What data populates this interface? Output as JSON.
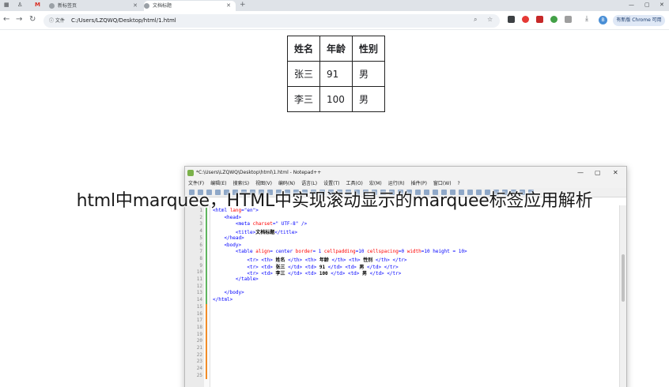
{
  "browser": {
    "tabs": [
      {
        "label": "新标签页"
      },
      {
        "label": "文档标题"
      }
    ],
    "address_chip": "文件",
    "url": "C:/Users/LZQWQ/Desktop/html/1.html",
    "profile_initial": "B",
    "chrome_pill": "有新版 Chrome 可用",
    "icons": [
      "back-icon",
      "forward-icon",
      "reload-icon",
      "zoom-icon",
      "star-icon",
      "extension-icon",
      "download-icon",
      "menu-icon"
    ]
  },
  "page_table": {
    "headers": [
      "姓名",
      "年龄",
      "性别"
    ],
    "rows": [
      [
        "张三",
        "91",
        "男"
      ],
      [
        "李三",
        "100",
        "男"
      ]
    ]
  },
  "notepad": {
    "title": "*C:\\Users\\LZQWQ\\Desktop\\html\\1.html - Notepad++",
    "menu": [
      "文件(F)",
      "编辑(E)",
      "搜索(S)",
      "视图(V)",
      "编码(N)",
      "语言(L)",
      "设置(T)",
      "工具(O)",
      "宏(M)",
      "运行(R)",
      "插件(P)",
      "窗口(W)",
      "?"
    ],
    "code_lines": [
      {
        "n": "1",
        "text": "<html lang=\"en\">"
      },
      {
        "n": "2",
        "text": "    <head>"
      },
      {
        "n": "3",
        "text": "        <meta charset=\" UTF-8\" />"
      },
      {
        "n": "4",
        "text": "        <title>文档标题</title>"
      },
      {
        "n": "5",
        "text": "    </head>"
      },
      {
        "n": "6",
        "text": "    <body>"
      },
      {
        "n": "7",
        "text": "        <table align= center border= 1 cellpadding=10 cellspacing=0 width=10 height = 10>"
      },
      {
        "n": "8",
        "text": "            <tr> <th> 姓名 </th> <th> 年龄 </th> <th> 性别 </th> </tr>"
      },
      {
        "n": "9",
        "text": "            <tr> <td> 张三 </td> <td> 91 </td> <td> 男 </td> </tr>"
      },
      {
        "n": "10",
        "text": "            <tr> <td> 李三 </td> <td> 100 </td> <td> 男 </td> </tr>"
      },
      {
        "n": "11",
        "text": "        </table>"
      },
      {
        "n": "12",
        "text": ""
      },
      {
        "n": "13",
        "text": "    </body>"
      },
      {
        "n": "14",
        "text": "</html>"
      },
      {
        "n": "15",
        "text": ""
      },
      {
        "n": "16",
        "text": ""
      },
      {
        "n": "17",
        "text": ""
      },
      {
        "n": "18",
        "text": ""
      },
      {
        "n": "19",
        "text": ""
      },
      {
        "n": "20",
        "text": ""
      },
      {
        "n": "21",
        "text": ""
      },
      {
        "n": "22",
        "text": ""
      },
      {
        "n": "23",
        "text": ""
      },
      {
        "n": "24",
        "text": ""
      },
      {
        "n": "25",
        "text": ""
      }
    ]
  },
  "caption": "html中marquee，HTML中实现滚动显示的marquee标签应用解析",
  "colors": {
    "changebar_saved": "#5fb55f",
    "changebar_unsaved": "#f28c28"
  }
}
